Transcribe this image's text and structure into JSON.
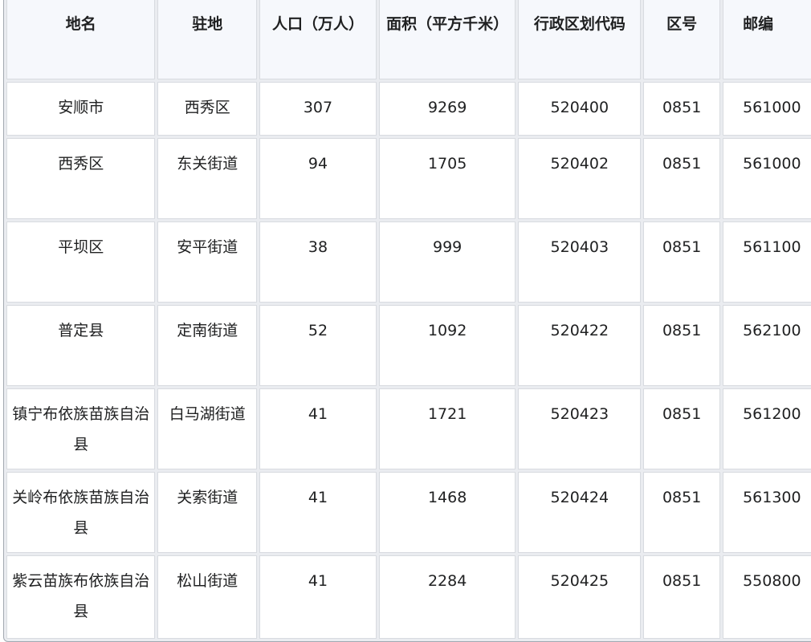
{
  "table": {
    "headers": [
      "地名",
      "驻地",
      "人口（万人）",
      "面积（平方千米）",
      "行政区划代码",
      "区号",
      "邮编"
    ],
    "rows": [
      {
        "name": "安顺市",
        "seat": "西秀区",
        "population": "307",
        "area": "9269",
        "code": "520400",
        "area_code": "0851",
        "postcode": "561000"
      },
      {
        "name": "西秀区",
        "seat": "东关街道",
        "population": "94",
        "area": "1705",
        "code": "520402",
        "area_code": "0851",
        "postcode": "561000"
      },
      {
        "name": "平坝区",
        "seat": "安平街道",
        "population": "38",
        "area": "999",
        "code": "520403",
        "area_code": "0851",
        "postcode": "561100"
      },
      {
        "name": "普定县",
        "seat": "定南街道",
        "population": "52",
        "area": "1092",
        "code": "520422",
        "area_code": "0851",
        "postcode": "562100"
      },
      {
        "name": "镇宁布依族苗族自治县",
        "seat": "白马湖街道",
        "population": "41",
        "area": "1721",
        "code": "520423",
        "area_code": "0851",
        "postcode": "561200"
      },
      {
        "name": "关岭布依族苗族自治县",
        "seat": "关索街道",
        "population": "41",
        "area": "1468",
        "code": "520424",
        "area_code": "0851",
        "postcode": "561300"
      },
      {
        "name": "紫云苗族布依族自治县",
        "seat": "松山街道",
        "population": "41",
        "area": "2284",
        "code": "520425",
        "area_code": "0851",
        "postcode": "550800"
      }
    ]
  }
}
